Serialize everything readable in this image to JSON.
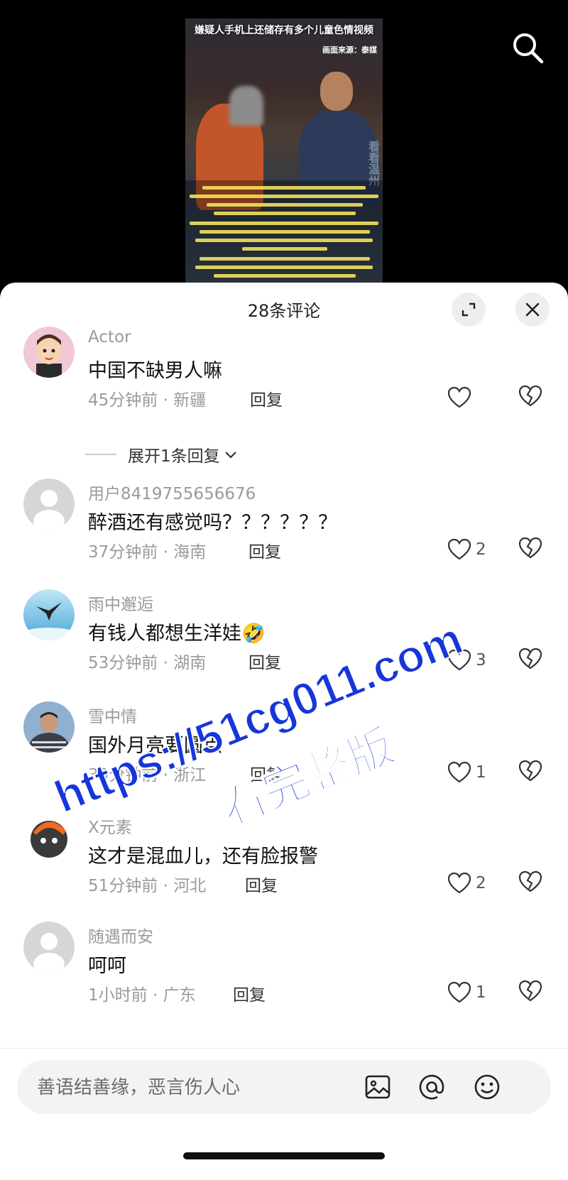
{
  "video": {
    "headline": "嫌疑人手机上还储存有多个儿童色情视频",
    "source": "画面来源：泰媒",
    "watermark": "看看温州"
  },
  "sheet": {
    "title": "28条评论"
  },
  "comments": [
    {
      "user": "Actor",
      "text": "中国不缺男人嘛",
      "meta": "45分钟前 · 新疆",
      "reply": "回复",
      "likes": ""
    },
    {
      "user": "用户8419755656676",
      "text": "醉酒还有感觉吗？？？？？？",
      "meta": "37分钟前 · 海南",
      "reply": "回复",
      "likes": "2"
    },
    {
      "user": "雨中邂逅",
      "text": "有钱人都想生洋娃🤣",
      "meta": "53分钟前 · 湖南",
      "reply": "回复",
      "likes": "3"
    },
    {
      "user": "雪中情",
      "text": "国外月亮要圆点",
      "meta": "39分钟前 · 浙江",
      "reply": "回复",
      "likes": "1"
    },
    {
      "user": "X元素",
      "text": "这才是混血儿，还有脸报警",
      "meta": "51分钟前 · 河北",
      "reply": "回复",
      "likes": "2"
    },
    {
      "user": "随遇而安",
      "text": "呵呵",
      "meta": "1小时前 · 广东",
      "reply": "回复",
      "likes": "1"
    }
  ],
  "expand_replies": "展开1条回复",
  "input": {
    "placeholder": "善语结善缘，恶言伤人心"
  },
  "overlay": {
    "url": "https://51cg011.com",
    "subtitle": "看完整版"
  },
  "colors": {
    "watermark_blue": "#1636d9",
    "subtitle_yellow": "#f3e25a"
  }
}
